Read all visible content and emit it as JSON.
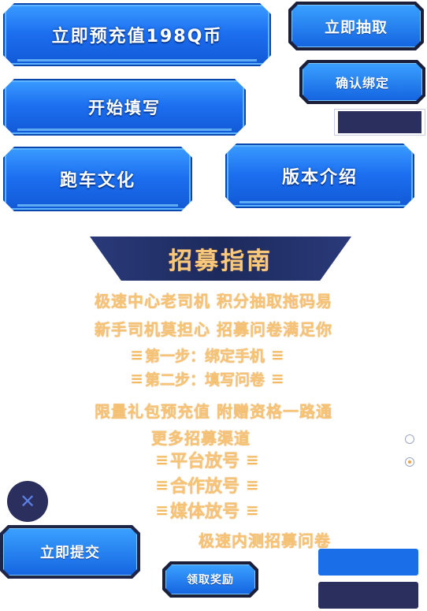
{
  "buttons": {
    "precharge": "立即预充值198Q币",
    "draw_now": "立即抽取",
    "confirm_bind": "确认绑定",
    "start_fill": "开始填写",
    "car_culture": "跑车文化",
    "version_intro": "版本介绍",
    "submit_now": "立即提交",
    "claim_reward": "领取奖励"
  },
  "guide": {
    "title": "招募指南",
    "line1": "极速中心老司机 积分抽取拖码易",
    "line2": "新手司机莫担心 招募问卷满足你",
    "step1": "第一步：绑定手机",
    "step2": "第二步：填写问卷",
    "line3": "限量礼包预充值 附赠资格一路通",
    "more_channels": "更多招募渠道",
    "channel1": "平台放号",
    "channel2": "合作放号",
    "channel3": "媒体放号",
    "footer": "极速内测招募问卷"
  },
  "icons": {
    "close": "close-icon",
    "close_symbol": "✕"
  },
  "colors": {
    "blue": "#1c6ff0",
    "navy": "#2b2f5e",
    "gold": "#f7c477"
  }
}
